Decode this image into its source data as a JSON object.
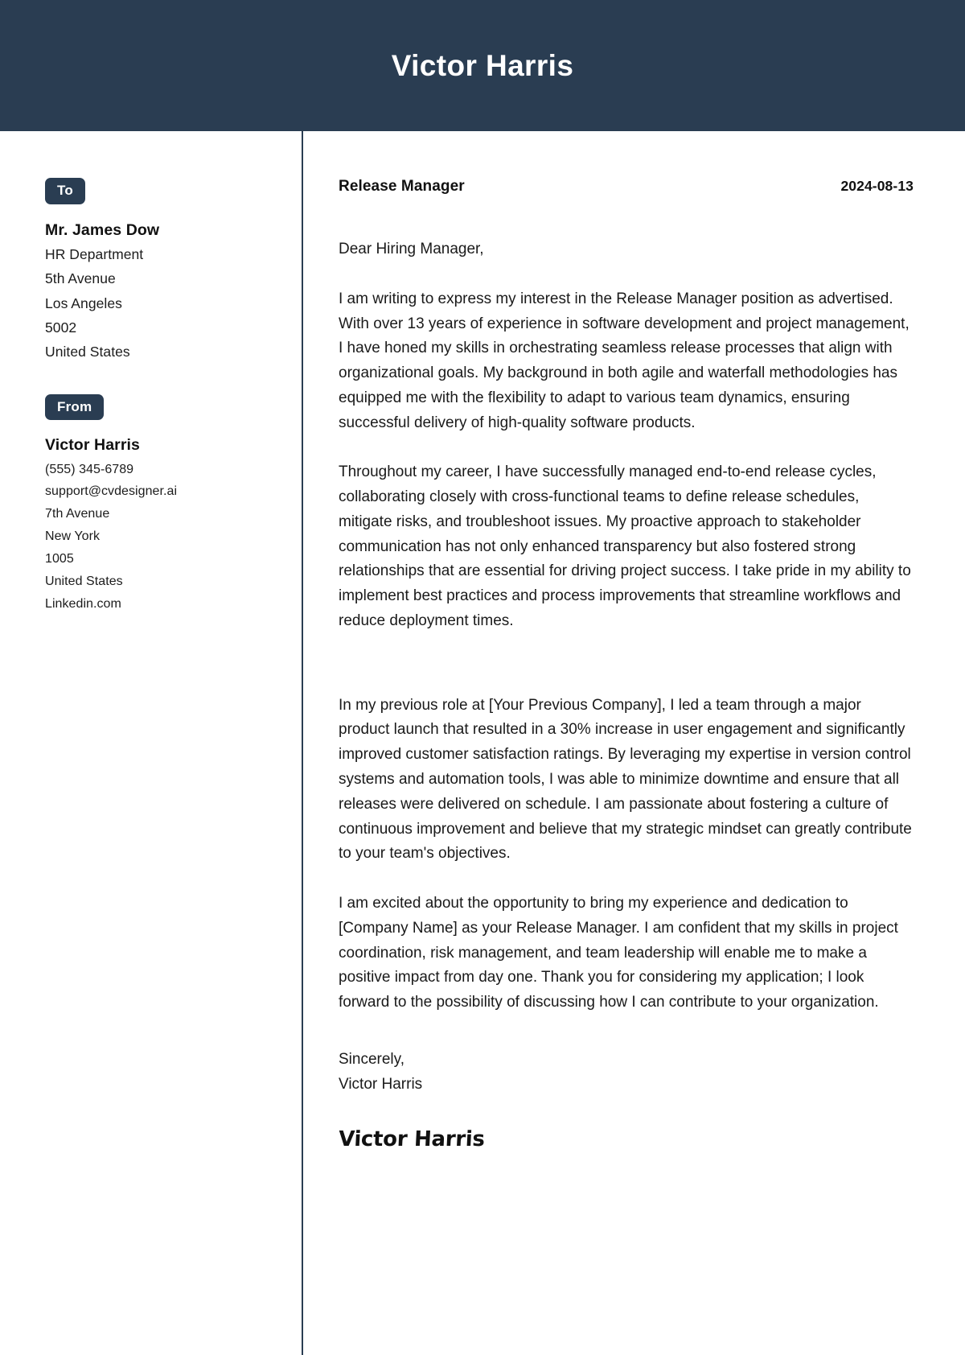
{
  "header": {
    "full_name": "Victor Harris",
    "background_color": "#2a3d52",
    "text_color": "#ffffff"
  },
  "sidebar": {
    "to": {
      "badge_label": "To",
      "recipient_name": "Mr. James Dow",
      "lines": [
        "HR Department",
        "5th Avenue",
        "Los Angeles",
        "5002",
        "United States"
      ]
    },
    "from": {
      "badge_label": "From",
      "sender_name": "Victor Harris",
      "lines": [
        "(555) 345-6789",
        "support@cvdesigner.ai",
        "7th Avenue",
        "New York",
        "1005",
        "United States",
        "Linkedin.com"
      ]
    }
  },
  "letter": {
    "job_title": "Release Manager",
    "date": "2024-08-13",
    "salutation": "Dear Hiring Manager,",
    "paragraphs": [
      "I am writing to express my interest in the Release Manager position as advertised. With over 13 years of experience in software development and project management, I have honed my skills in orchestrating seamless release processes that align with organizational goals. My background in both agile and waterfall methodologies has equipped me with the flexibility to adapt to various team dynamics, ensuring successful delivery of high-quality software products.",
      "Throughout my career, I have successfully managed end-to-end release cycles, collaborating closely with cross-functional teams to define release schedules, mitigate risks, and troubleshoot issues. My proactive approach to stakeholder communication has not only enhanced transparency but also fostered strong relationships that are essential for driving project success. I take pride in my ability to implement best practices and process improvements that streamline workflows and reduce deployment times.",
      "In my previous role at [Your Previous Company], I led a team through a major product launch that resulted in a 30% increase in user engagement and significantly improved customer satisfaction ratings. By leveraging my expertise in version control systems and automation tools, I was able to minimize downtime and ensure that all releases were delivered on schedule. I am passionate about fostering a culture of continuous improvement and believe that my strategic mindset can greatly contribute to your team's objectives.",
      "I am excited about the opportunity to bring my experience and dedication to [Company Name] as your Release Manager. I am confident that my skills in project coordination, risk management, and team leadership will enable me to make a positive impact from day one. Thank you for considering my application; I look forward to the possibility of discussing how I can contribute to your organization."
    ],
    "closing": "Sincerely,",
    "closing_name": "Victor Harris",
    "signature": "Victor Harris"
  },
  "theme": {
    "accent": "#2a3d52",
    "page_background": "#ffffff",
    "body_text": "#1a1a1a"
  }
}
